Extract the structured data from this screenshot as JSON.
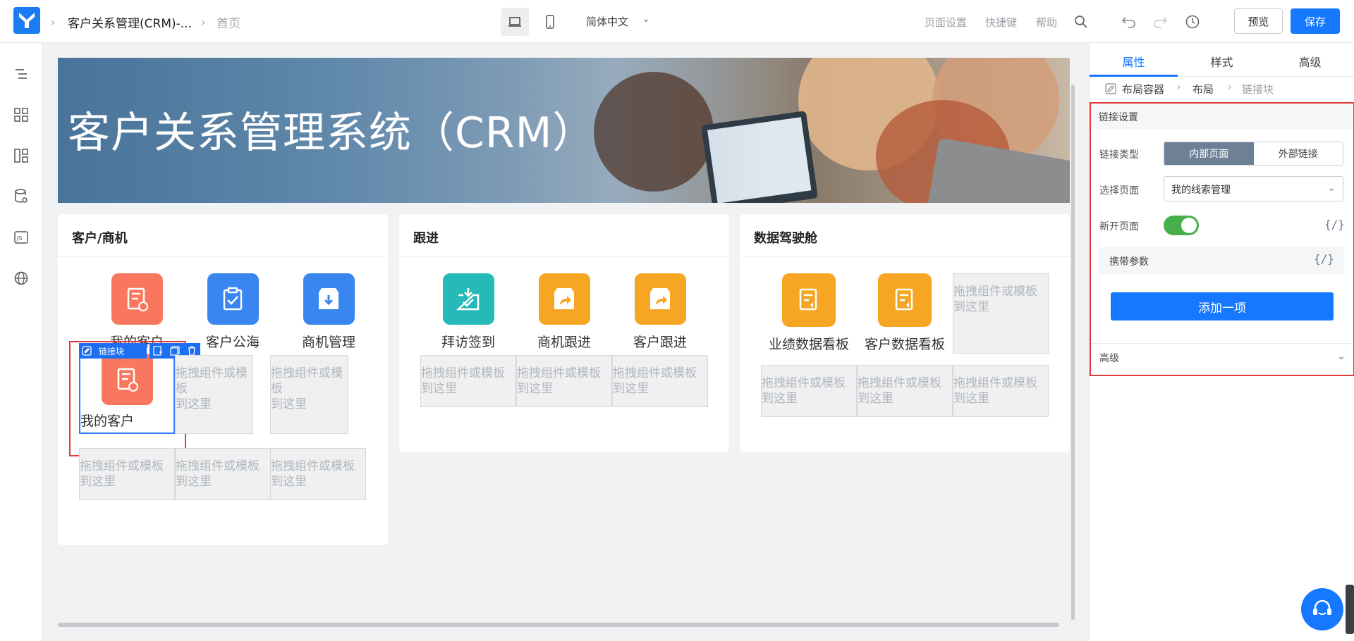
{
  "topbar": {
    "app_name": "客户关系管理(CRM)-...",
    "page_name": "首页",
    "language": "简体中文",
    "page_settings": "页面设置",
    "shortcuts": "快捷键",
    "help": "帮助",
    "preview": "预览",
    "save": "保存"
  },
  "banner": {
    "title": "客户关系管理系统（CRM）"
  },
  "cards": {
    "customer": {
      "title": "客户/商机",
      "items": [
        "我的客户",
        "客户公海",
        "商机管理"
      ],
      "selected_label": "我的客户",
      "selected_toolbar": "链接块",
      "partial_label": "我的客户"
    },
    "followup": {
      "title": "跟进",
      "items": [
        "拜访签到",
        "商机跟进",
        "客户跟进"
      ]
    },
    "cockpit": {
      "title": "数据驾驶舱",
      "items": [
        "业绩数据看板",
        "客户数据看板"
      ]
    },
    "placeholder_line1": "拖拽组件或模板",
    "placeholder_line2": "到这里"
  },
  "panel": {
    "tabs": [
      "属性",
      "样式",
      "高级"
    ],
    "breadcrumb": [
      "布局容器",
      "布局",
      "链接块"
    ],
    "section_title": "链接设置",
    "link_type_label": "链接类型",
    "link_type_options": [
      "内部页面",
      "外部链接"
    ],
    "select_page_label": "选择页面",
    "select_page_value": "我的线索管理",
    "new_page_label": "新开页面",
    "new_page_on": true,
    "params_label": "携带参数",
    "code_icon": "{/}",
    "add_item": "添加一项",
    "advanced": "高级"
  },
  "colors": {
    "primary": "#1677ff",
    "highlight_red": "#e23a3a",
    "icon_salmon": "#f9775d",
    "icon_blue": "#3a86f0",
    "icon_teal": "#25b9b8",
    "icon_orange": "#f6a623"
  },
  "icons": [
    "laptop-icon",
    "mobile-icon",
    "search-icon",
    "undo-icon",
    "redo-icon",
    "history-icon"
  ]
}
